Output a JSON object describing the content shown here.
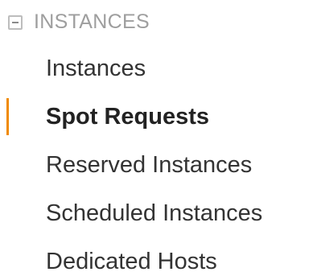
{
  "section": {
    "title": "INSTANCES",
    "icon": "collapse-minus-icon"
  },
  "colors": {
    "active_marker": "#f08a00",
    "section_title": "#9e9e9e",
    "item_text": "#333333"
  },
  "items": [
    {
      "label": "Instances",
      "active": false
    },
    {
      "label": "Spot Requests",
      "active": true
    },
    {
      "label": "Reserved Instances",
      "active": false
    },
    {
      "label": "Scheduled Instances",
      "active": false
    },
    {
      "label": "Dedicated Hosts",
      "active": false
    }
  ]
}
